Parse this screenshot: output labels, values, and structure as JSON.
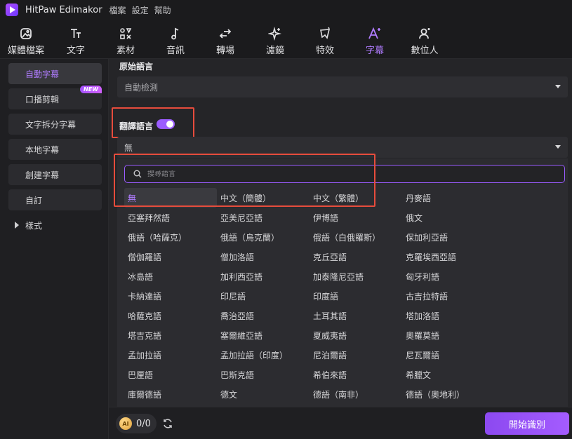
{
  "app": {
    "name": "HitPaw Edimakor"
  },
  "menu": [
    "檔案",
    "設定",
    "幫助"
  ],
  "toolbar": {
    "tabs": [
      {
        "label": "媒體檔案",
        "icon": "media-icon"
      },
      {
        "label": "文字",
        "icon": "text-icon"
      },
      {
        "label": "素材",
        "icon": "elements-icon"
      },
      {
        "label": "音訊",
        "icon": "music-note-icon"
      },
      {
        "label": "轉場",
        "icon": "transition-icon"
      },
      {
        "label": "濾鏡",
        "icon": "sparkle-icon"
      },
      {
        "label": "特效",
        "icon": "effects-icon"
      },
      {
        "label": "字幕",
        "icon": "subtitle-icon",
        "active": true
      },
      {
        "label": "數位人",
        "icon": "avatar-icon"
      }
    ]
  },
  "sidebar": {
    "items": [
      {
        "label": "自動字幕",
        "active": true
      },
      {
        "label": "口播剪輯",
        "badge": "NEW"
      },
      {
        "label": "文字拆分字幕"
      },
      {
        "label": "本地字幕"
      },
      {
        "label": "創建字幕"
      },
      {
        "label": "自訂"
      },
      {
        "label": "樣式",
        "expandable": true
      }
    ]
  },
  "main": {
    "source_language": {
      "title": "原始語言",
      "value": "自動檢測"
    },
    "translate": {
      "title": "翻譯語言",
      "enabled": true,
      "value": "無"
    },
    "dropdown": {
      "search_placeholder": "搜尋語言",
      "languages": [
        "無",
        "中文（簡體）",
        "中文（繁體）",
        "丹麥語",
        "亞塞拜然語",
        "亞美尼亞語",
        "伊博語",
        "俄文",
        "俄語（哈薩克）",
        "俄語（烏克蘭）",
        "俄語（白俄羅斯）",
        "保加利亞語",
        "僧伽羅語",
        "僧加洛語",
        "克丘亞語",
        "克羅埃西亞語",
        "冰島語",
        "加利西亞語",
        "加泰隆尼亞語",
        "匈牙利語",
        "卡納達語",
        "印尼語",
        "印度語",
        "古吉拉特語",
        "哈薩克語",
        "喬治亞語",
        "土耳其語",
        "塔加洛語",
        "塔吉克語",
        "塞爾維亞語",
        "夏威夷語",
        "奧羅莫語",
        "孟加拉語",
        "孟加拉語（印度）",
        "尼泊爾語",
        "尼瓦爾語",
        "巴厘語",
        "巴斯克語",
        "希伯來語",
        "希臘文",
        "庫爾德語",
        "德文",
        "德語（南非）",
        "德語（奧地利）"
      ],
      "selected": "無"
    }
  },
  "bottom": {
    "credits": "0/0",
    "ai_badge": "AI",
    "start_button": "開始識別"
  },
  "colors": {
    "accent": "#9b5cff",
    "highlight": "#e74c3c"
  }
}
